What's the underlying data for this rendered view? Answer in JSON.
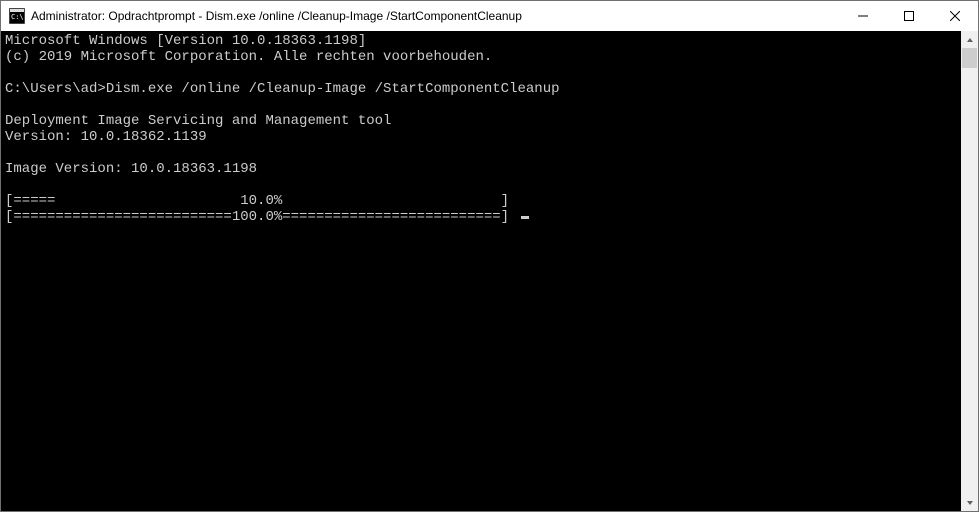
{
  "window": {
    "title": "Administrator: Opdrachtprompt - Dism.exe  /online /Cleanup-Image /StartComponentCleanup"
  },
  "console": {
    "line1": "Microsoft Windows [Version 10.0.18363.1198]",
    "line2": "(c) 2019 Microsoft Corporation. Alle rechten voorbehouden.",
    "blank1": "",
    "prompt": "C:\\Users\\ad>Dism.exe /online /Cleanup-Image /StartComponentCleanup",
    "blank2": "",
    "tool1": "Deployment Image Servicing and Management tool",
    "tool2": "Version: 10.0.18362.1139",
    "blank3": "",
    "imgver": "Image Version: 10.0.18363.1198",
    "blank4": "",
    "progress1": "[=====                      10.0%                          ]",
    "progress2": "[==========================100.0%==========================] "
  }
}
